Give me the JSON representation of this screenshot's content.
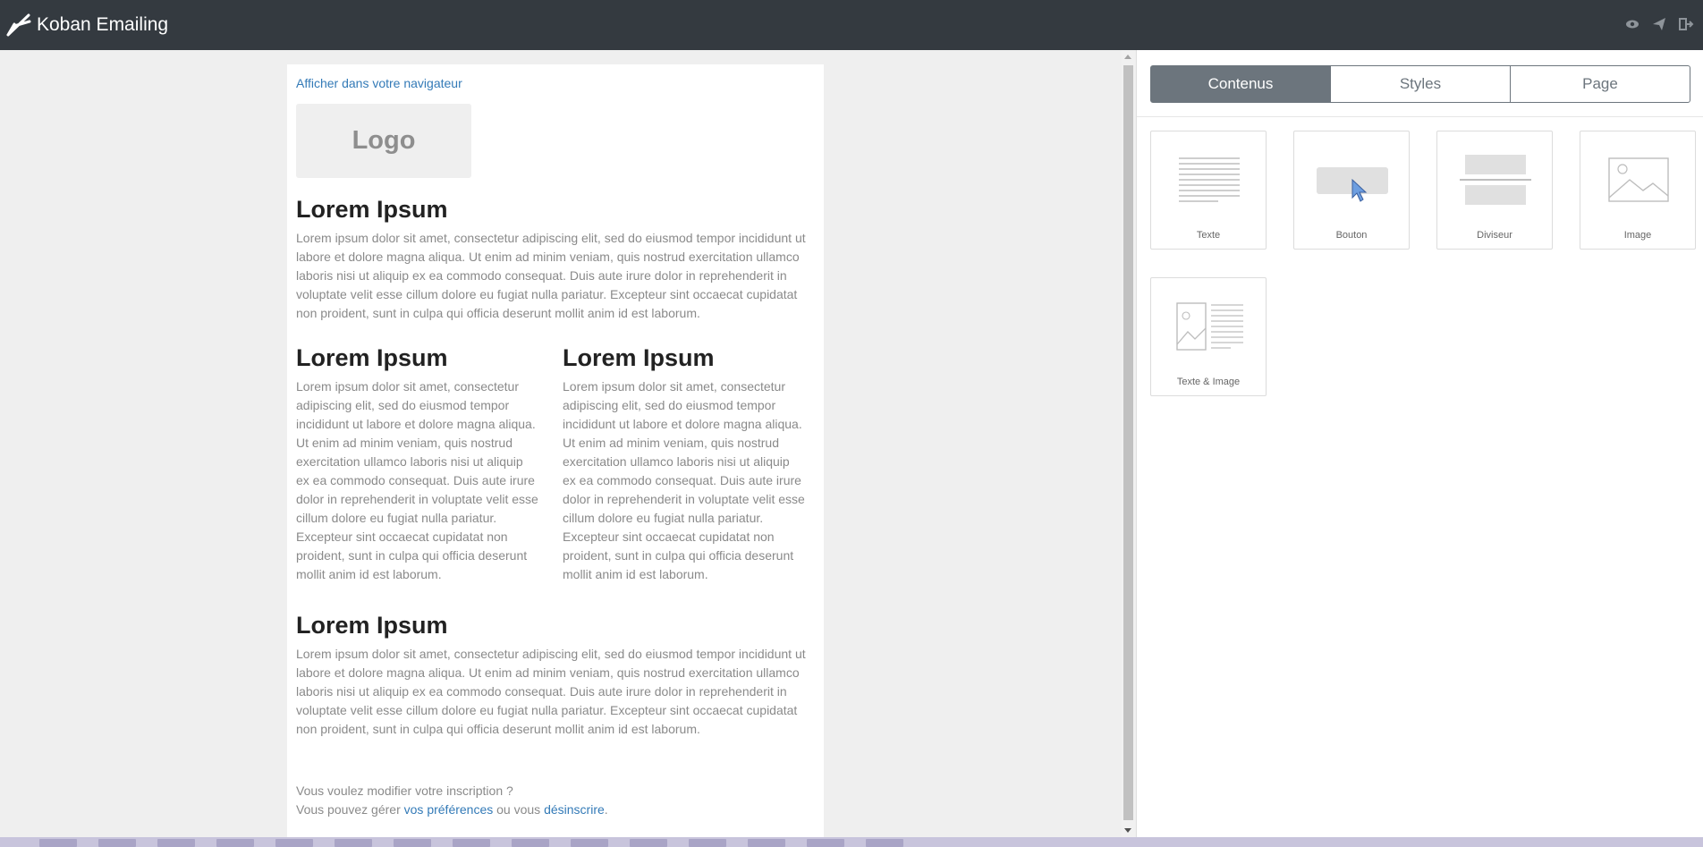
{
  "app": {
    "title": "Koban Emailing"
  },
  "header": {
    "icons": [
      "eye-icon",
      "paper-plane-icon",
      "sign-out-icon"
    ]
  },
  "email": {
    "view_in_browser": "Afficher dans votre navigateur",
    "logo_text": "Logo",
    "section1": {
      "heading": "Lorem Ipsum",
      "body": "Lorem ipsum dolor sit amet, consectetur adipiscing elit, sed do eiusmod tempor incididunt ut labore et dolore magna aliqua. Ut enim ad minim veniam, quis nostrud exercitation ullamco laboris nisi ut aliquip ex ea commodo consequat. Duis aute irure dolor in reprehenderit in voluptate velit esse cillum dolore eu fugiat nulla pariatur. Excepteur sint occaecat cupidatat non proident, sunt in culpa qui officia deserunt mollit anim id est laborum."
    },
    "col_left": {
      "heading": "Lorem Ipsum",
      "body": "Lorem ipsum dolor sit amet, consectetur adipiscing elit, sed do eiusmod tempor incididunt ut labore et dolore magna aliqua. Ut enim ad minim veniam, quis nostrud exercitation ullamco laboris nisi ut aliquip ex ea commodo consequat. Duis aute irure dolor in reprehenderit in voluptate velit esse cillum dolore eu fugiat nulla pariatur. Excepteur sint occaecat cupidatat non proident, sunt in culpa qui officia deserunt mollit anim id est laborum."
    },
    "col_right": {
      "heading": "Lorem Ipsum",
      "body": "Lorem ipsum dolor sit amet, consectetur adipiscing elit, sed do eiusmod tempor incididunt ut labore et dolore magna aliqua. Ut enim ad minim veniam, quis nostrud exercitation ullamco laboris nisi ut aliquip ex ea commodo consequat. Duis aute irure dolor in reprehenderit in voluptate velit esse cillum dolore eu fugiat nulla pariatur. Excepteur sint occaecat cupidatat non proident, sunt in culpa qui officia deserunt mollit anim id est laborum."
    },
    "section3": {
      "heading": "Lorem Ipsum",
      "body": "Lorem ipsum dolor sit amet, consectetur adipiscing elit, sed do eiusmod tempor incididunt ut labore et dolore magna aliqua. Ut enim ad minim veniam, quis nostrud exercitation ullamco laboris nisi ut aliquip ex ea commodo consequat. Duis aute irure dolor in reprehenderit in voluptate velit esse cillum dolore eu fugiat nulla pariatur. Excepteur sint occaecat cupidatat non proident, sunt in culpa qui officia deserunt mollit anim id est laborum."
    },
    "footer": {
      "line1": "Vous voulez modifier votre inscription ?",
      "line2_prefix": "Vous pouvez gérer ",
      "preferences_link": "vos préférences",
      "line2_middle": " ou vous ",
      "unsubscribe_link": "désinscrire",
      "line2_suffix": "."
    }
  },
  "panel": {
    "tabs": [
      {
        "label": "Contenus",
        "active": true
      },
      {
        "label": "Styles",
        "active": false
      },
      {
        "label": "Page",
        "active": false
      }
    ],
    "blocks": [
      {
        "label": "Texte",
        "icon": "text-lines-icon"
      },
      {
        "label": "Bouton",
        "icon": "button-cursor-icon"
      },
      {
        "label": "Diviseur",
        "icon": "divider-icon"
      },
      {
        "label": "Image",
        "icon": "image-icon"
      },
      {
        "label": "Texte & Image",
        "icon": "text-image-icon"
      }
    ]
  },
  "colors": {
    "topbar": "#343a40",
    "link": "#337ab7",
    "tab_active": "#6c757d",
    "canvas_bg": "#efefef"
  }
}
